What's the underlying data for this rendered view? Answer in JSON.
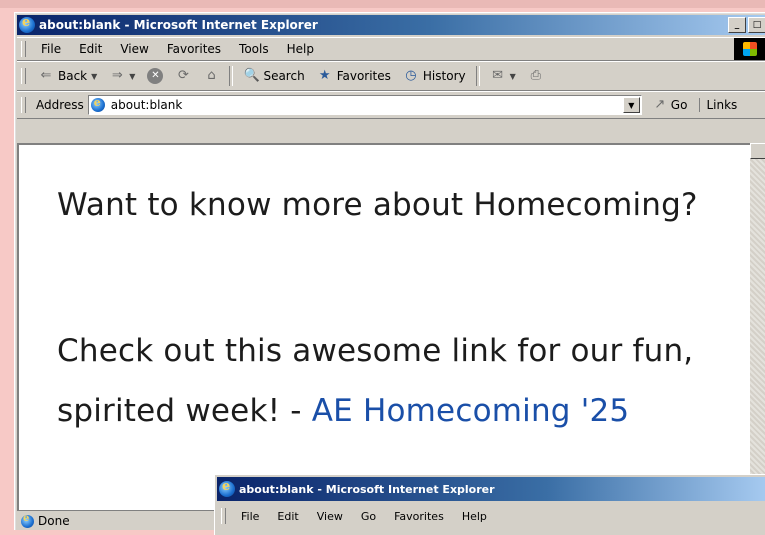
{
  "window": {
    "title": "about:blank - Microsoft Internet Explorer",
    "buttons": {
      "minimize": "_",
      "maximize": "□"
    }
  },
  "menu": {
    "items": [
      "File",
      "Edit",
      "View",
      "Favorites",
      "Tools",
      "Help"
    ]
  },
  "toolbar": {
    "back": "Back",
    "search": "Search",
    "favorites": "Favorites",
    "history": "History"
  },
  "address": {
    "label": "Address",
    "value": "about:blank",
    "go": "Go",
    "links": "Links"
  },
  "content": {
    "line1": "Want to know more about Homecoming?",
    "line2": "Check out this awesome link for our fun,",
    "line3_prefix": "spirited week! - ",
    "link_text": "AE Homecoming '25",
    "link_color": "#1a4fa8"
  },
  "status": {
    "text": "Done"
  },
  "window2": {
    "title": "about:blank - Microsoft Internet Explorer",
    "menu": [
      "File",
      "Edit",
      "View",
      "Go",
      "Favorites",
      "Help"
    ]
  }
}
